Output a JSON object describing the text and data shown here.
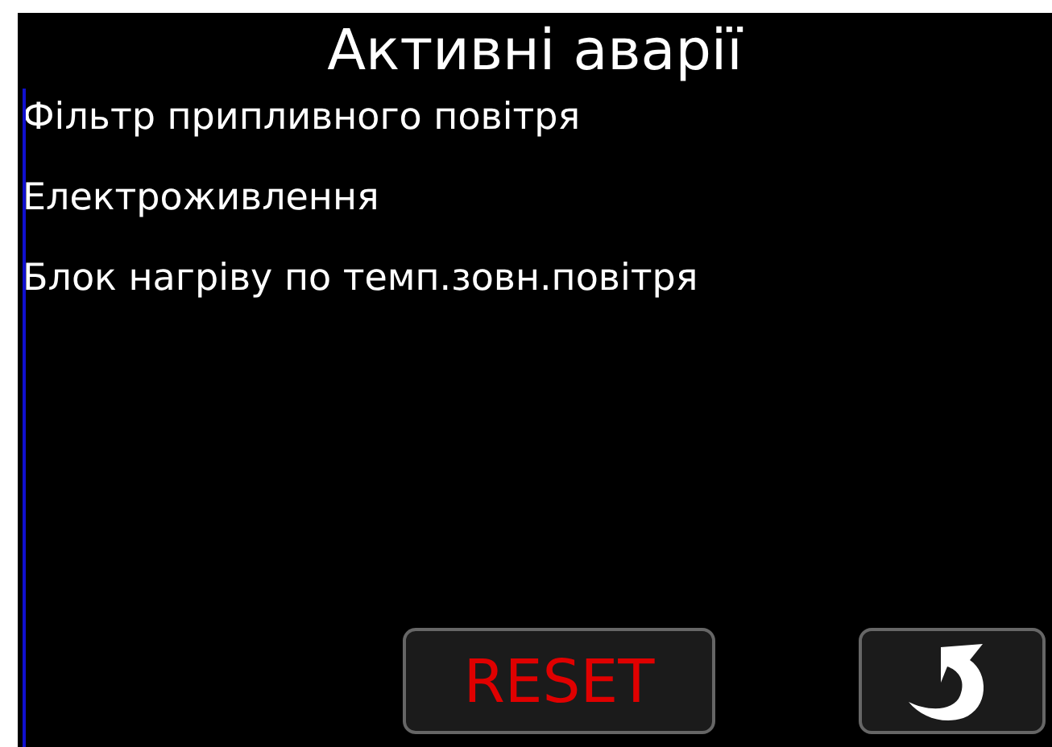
{
  "title": "Активні аварії",
  "alarms": [
    "Фільтр припливного повітря",
    "Електроживлення",
    "Блок нагріву по темп.зовн.повітря"
  ],
  "reset_button": "RESET"
}
